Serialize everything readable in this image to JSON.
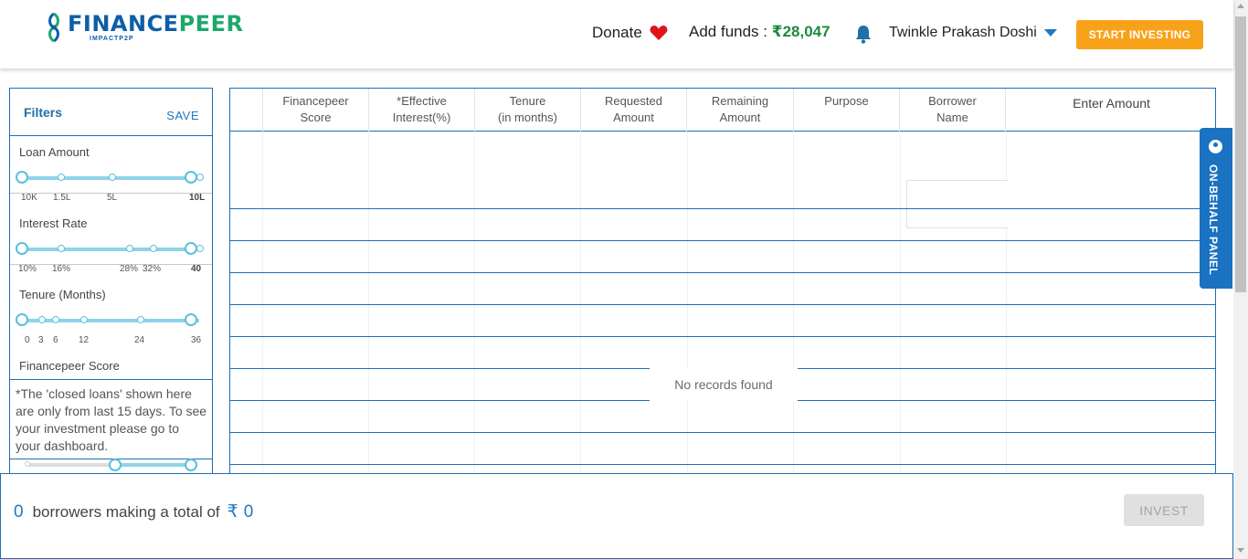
{
  "header": {
    "logo_finance": "FINANCE",
    "logo_peer": "PEER",
    "logo_sub": "IMPACTP2P",
    "donate_label": "Donate",
    "add_funds_label": "Add funds :",
    "add_funds_amount": "₹28,047",
    "user_name": "Twinkle Prakash Doshi",
    "start_investing_label": "START INVESTING"
  },
  "filters": {
    "title": "Filters",
    "save_label": "SAVE",
    "groups": [
      {
        "label": "Loan Amount",
        "ticks": [
          "10K",
          "1.5L",
          "5L",
          "10L"
        ]
      },
      {
        "label": "Interest Rate",
        "ticks": [
          "10%",
          "16%",
          "28%",
          "32%",
          "40"
        ]
      },
      {
        "label": "Tenure (Months)",
        "ticks": [
          "0",
          "3",
          "6",
          "12",
          "24",
          "36"
        ]
      },
      {
        "label": "Financepeer Score"
      }
    ],
    "note": "*The 'closed loans' shown here are only from last 15 days. To see your investment please go to your dashboard."
  },
  "table": {
    "columns": [
      {
        "label": ""
      },
      {
        "label": "Financepeer\nScore"
      },
      {
        "label": "*Effective\nInterest(%)"
      },
      {
        "label": "Tenure\n(in months)"
      },
      {
        "label": "Requested\nAmount"
      },
      {
        "label": "Remaining\nAmount"
      },
      {
        "label": "Purpose"
      },
      {
        "label": "Borrower\nName"
      },
      {
        "label": "Enter Amount"
      }
    ],
    "empty_message": "No records found"
  },
  "behalf_panel": {
    "label": "ON-BEHALF PANEL"
  },
  "footer": {
    "borrower_count": "0",
    "summary_text": "borrowers making a total of",
    "currency_symbol": "₹",
    "total_amount": "0",
    "invest_label": "INVEST"
  },
  "colors": {
    "brand_blue": "#0d5ea8",
    "brand_green": "#1ea86b",
    "accent_orange": "#f8a21a",
    "border_blue": "#1f6fb5",
    "slider_cyan": "#8fd3ea",
    "funds_green": "#1d8a3f"
  }
}
